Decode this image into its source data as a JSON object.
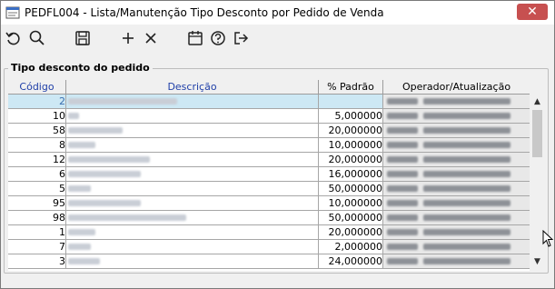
{
  "window": {
    "title": "PEDFL004 - Lista/Manutenção Tipo Desconto por Pedido de Venda",
    "close_label": "✕"
  },
  "toolbar": {
    "icons": [
      "undo-icon",
      "search-icon",
      "save-icon",
      "add-icon",
      "delete-icon",
      "calendar-icon",
      "help-icon",
      "exit-icon"
    ]
  },
  "group": {
    "title": "Tipo desconto do pedido"
  },
  "table": {
    "columns": [
      "Código",
      "Descrição",
      "% Padrão",
      "Operador/Atualização"
    ],
    "rows": [
      {
        "codigo": "2",
        "percent": ""
      },
      {
        "codigo": "10",
        "percent": "5,000000"
      },
      {
        "codigo": "58",
        "percent": "20,000000"
      },
      {
        "codigo": "8",
        "percent": "10,000000"
      },
      {
        "codigo": "12",
        "percent": "20,000000"
      },
      {
        "codigo": "6",
        "percent": "16,000000"
      },
      {
        "codigo": "5",
        "percent": "50,000000"
      },
      {
        "codigo": "95",
        "percent": "10,000000"
      },
      {
        "codigo": "98",
        "percent": "50,000000"
      },
      {
        "codigo": "1",
        "percent": "20,000000"
      },
      {
        "codigo": "7",
        "percent": "2,000000"
      },
      {
        "codigo": "3",
        "percent": "24,000000"
      }
    ],
    "selected_row": 0
  },
  "colors": {
    "selection": "#cde8f4",
    "header_text": "#1f3fa8",
    "close": "#c75050"
  }
}
